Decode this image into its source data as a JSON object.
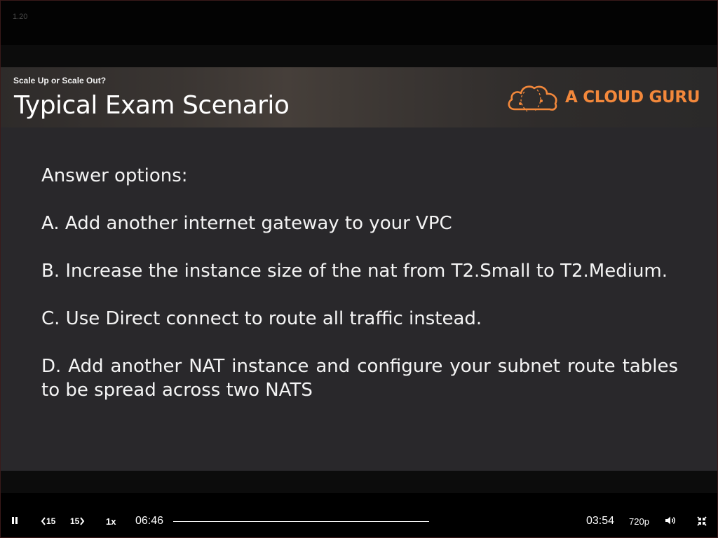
{
  "player": {
    "version": "1.20",
    "elapsed": "06:46",
    "remaining": "03:54",
    "quality": "720p",
    "speed": "1x",
    "skip_back_label": "15",
    "skip_forward_label": "15",
    "progress": 1.0
  },
  "slide": {
    "subtitle": "Scale Up or Scale Out?",
    "title": "Typical Exam Scenario",
    "logo_text": "A CLOUD GURU",
    "heading": "Answer options:",
    "options": [
      "A. Add another internet gateway to your VPC",
      "B. Increase the instance size of the nat from T2.Small to T2.Medium.",
      "C. Use Direct connect to route all traffic instead.",
      "D. Add another NAT instance and configure your subnet route tables to be spread across two NATS"
    ]
  },
  "colors": {
    "brand": "#f3883b",
    "slide_bg": "#29282b"
  },
  "icons": [
    "pause-icon",
    "skip-back-icon",
    "skip-forward-icon",
    "volume-icon",
    "exit-fullscreen-icon",
    "cloud-logo-icon"
  ]
}
